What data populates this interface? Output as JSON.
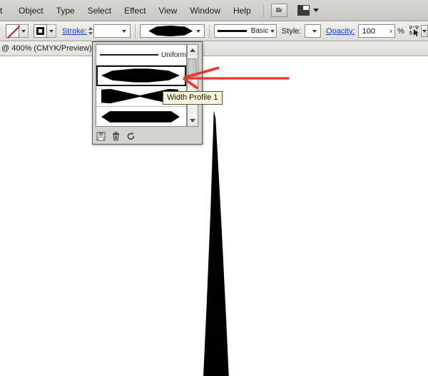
{
  "app": {
    "name": "Adobe Illustrator",
    "accent_link_color": "#1b3fd1",
    "annotation_color": "#e8352e",
    "tooltip_bg": "#fbf7da"
  },
  "menubar": {
    "items": [
      {
        "label": "t",
        "name": "menu-edit-clipped",
        "clipped": true
      },
      {
        "label": "Object",
        "name": "menu-object"
      },
      {
        "label": "Type",
        "name": "menu-type"
      },
      {
        "label": "Select",
        "name": "menu-select"
      },
      {
        "label": "Effect",
        "name": "menu-effect"
      },
      {
        "label": "View",
        "name": "menu-view"
      },
      {
        "label": "Window",
        "name": "menu-window"
      },
      {
        "label": "Help",
        "name": "menu-help"
      }
    ],
    "bridge_button_label": "Br",
    "arrange_documents_icon": "arrange-documents-icon",
    "arrange_caret_icon": "chevron-down-icon"
  },
  "controlbar": {
    "fill_swatch": {
      "name": "fill-swatch",
      "state": "none",
      "icon": "no-color-slash-icon"
    },
    "fill_dropdown_icon": "chevron-down-icon",
    "stroke_swatch": {
      "name": "stroke-swatch",
      "state": "black",
      "color": "#111111"
    },
    "stroke_dropdown_icon": "chevron-down-icon",
    "stroke_label": "Stroke:",
    "stroke_weight_value": "",
    "stroke_weight_placeholder": "",
    "stroke_stepper_icon": "up-down-stepper-icon",
    "stroke_weight_dropdown_icon": "chevron-down-icon",
    "width_profile": {
      "name": "width-profile-dropdown",
      "selected_shape": "lens",
      "dropdown_icon": "chevron-down-icon"
    },
    "brush_definition": {
      "name": "brush-definition-dropdown",
      "value": "Basic",
      "dropdown_icon": "chevron-down-icon"
    },
    "style_label": "Style:",
    "style_value": "",
    "style_dropdown_icon": "chevron-down-icon",
    "opacity_label": "Opacity:",
    "opacity_value": "100",
    "opacity_arrow": "›",
    "opacity_unit": "%",
    "transform_icon": "transform-anchor-icon",
    "transform_dropdown_icon": "chevron-down-icon"
  },
  "document_tab": {
    "title": "@ 400% (CMYK/Preview)",
    "close_icon": "close-icon",
    "close_glyph": "✕"
  },
  "profile_panel": {
    "name": "width-profile-panel",
    "rows": [
      {
        "label": "Uniform",
        "shape": "uniform-line",
        "selected": false
      },
      {
        "label": "",
        "shape": "lens",
        "selected": true
      },
      {
        "label": "",
        "shape": "bowtie",
        "selected": false
      },
      {
        "label": "",
        "shape": "flat-hex",
        "selected": false
      }
    ],
    "scrollbar": {
      "up_icon": "chevron-up-icon",
      "down_icon": "chevron-down-icon",
      "thumb": "scrollbar-thumb"
    },
    "footer_buttons": [
      {
        "name": "save-width-profile-button",
        "icon": "save-disk-icon",
        "glyph": "Ὃe"
      },
      {
        "name": "delete-width-profile-button",
        "icon": "trash-icon"
      },
      {
        "name": "reset-width-profiles-button",
        "icon": "reset-refresh-icon",
        "glyph": "↺"
      }
    ]
  },
  "tooltip": {
    "text": "Width Profile 1"
  },
  "annotation": {
    "name": "red-arrow-annotation",
    "description": "red arrow pointing left at the selected width profile",
    "color": "#e8352e"
  },
  "canvas": {
    "artwork": {
      "name": "tapered-blade-path",
      "color": "#000000",
      "description": "tall tapered stroke rendered with Width Profile 1"
    }
  }
}
